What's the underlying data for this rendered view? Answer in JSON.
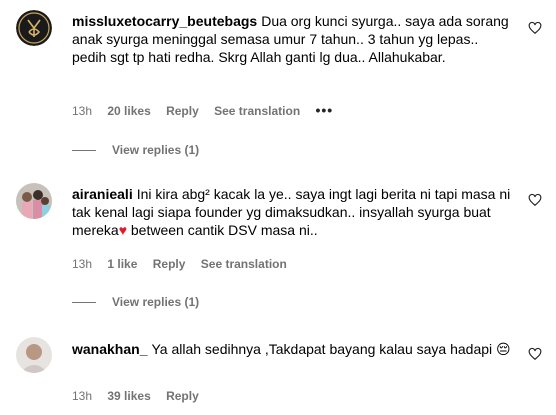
{
  "comments": [
    {
      "username": "missluxetocarry_beutebags",
      "text": "Dua org kunci syurga.. saya ada sorang anak syurga meninggal semasa umur 7 tahun.. 3 tahun yg lepas.. pedih sgt tp hati redha. Skrg Allah ganti lg dua.. Allahukabar.",
      "time": "13h",
      "likes": "20 likes",
      "reply": "Reply",
      "translate": "See translation",
      "more": "•••",
      "view_replies": "View replies (1)"
    },
    {
      "username": "airanieali",
      "text_before": "Ini kira abg² kacak la ye.. saya ingt lagi berita ni tapi masa ni tak kenal lagi siapa founder yg dimaksudkan.. insyallah syurga buat mereka",
      "text_heart": "♥",
      "text_after": " between cantik DSV masa ni..",
      "time": "13h",
      "likes": "1 like",
      "reply": "Reply",
      "translate": "See translation",
      "view_replies": "View replies (1)"
    },
    {
      "username": "wanakhan_",
      "text": "Ya allah sedihnya ,Takdapat bayang kalau saya hadapi 😔",
      "time": "13h",
      "likes": "39 likes",
      "reply": "Reply"
    }
  ],
  "icons": {
    "like": "heart-outline-icon",
    "more": "more-options-icon"
  },
  "colors": {
    "text": "#000000",
    "muted": "#737373",
    "heart_emoji": "#e11b2c"
  }
}
